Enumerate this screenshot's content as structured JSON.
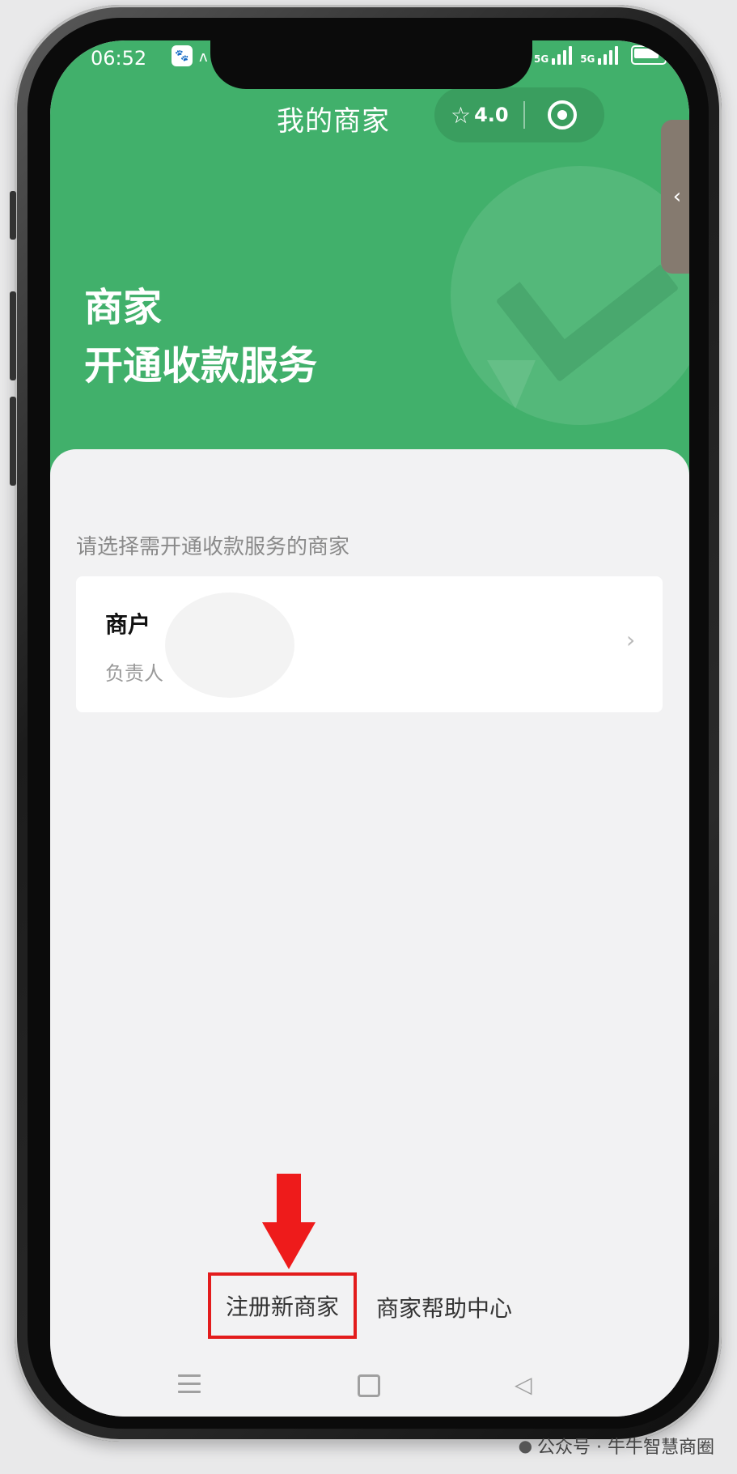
{
  "status_bar": {
    "time": "06:52",
    "network_labels": [
      "5G",
      "5G"
    ]
  },
  "header": {
    "title": "我的商家",
    "rating": "4.0",
    "hero_line1": "商家",
    "hero_line2": "开通收款服务",
    "side_tab_glyph": "‹"
  },
  "main": {
    "hint": "请选择需开通收款服务的商家",
    "merchant": {
      "name": "商户",
      "owner_label": "负责人"
    }
  },
  "actions": {
    "register_label": "注册新商家",
    "help_label": "商家帮助中心"
  },
  "footer": {
    "credit": "公众号 · 牛牛智慧商圈"
  },
  "colors": {
    "brand_green": "#41b06b",
    "highlight_red": "#e31c1c"
  },
  "icons": {
    "star": "star-icon",
    "target": "target-icon",
    "menu": "menu-icon",
    "home": "home-icon",
    "back": "back-icon",
    "chevron": "chevron-right-icon"
  }
}
